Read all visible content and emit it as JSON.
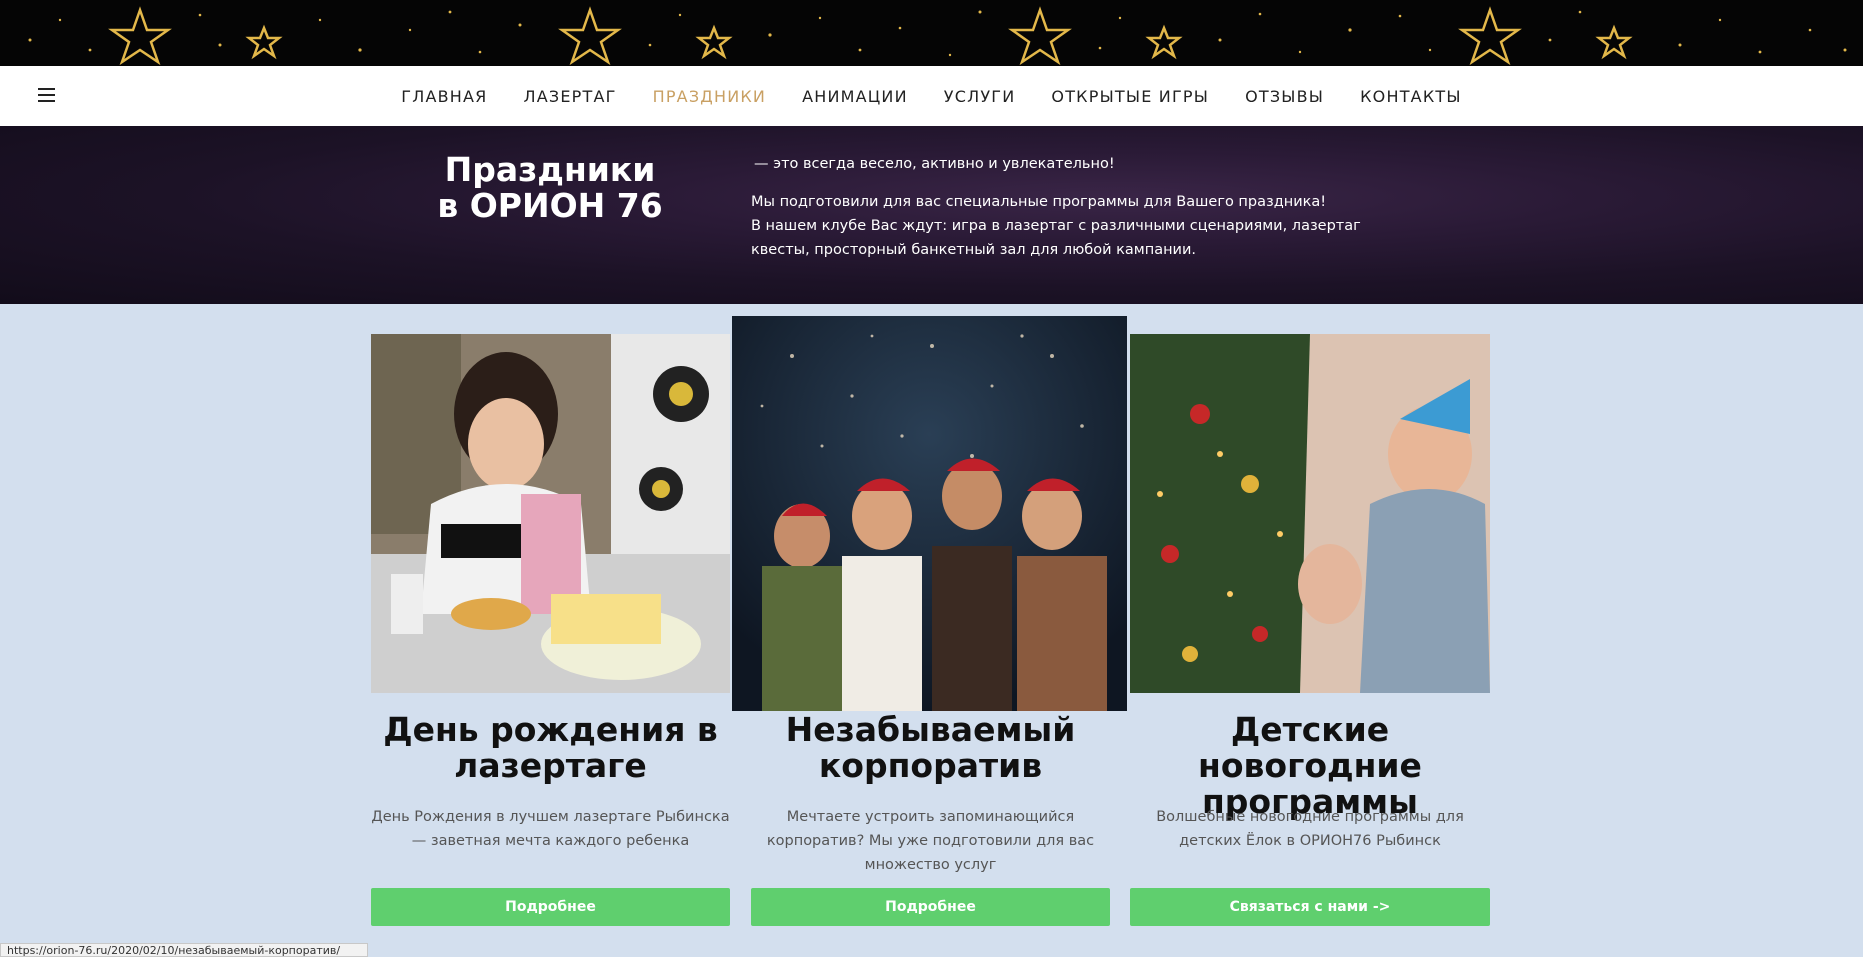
{
  "colors": {
    "nav_active": "#c9a063",
    "button_green": "#5fcf6e",
    "page_bg": "#d3dfee",
    "hero_bg": "#1c1226"
  },
  "icons": [
    "menu-icon",
    "star-decoration"
  ],
  "nav": {
    "items": [
      {
        "label": "ГЛАВНАЯ",
        "active": false
      },
      {
        "label": "ЛАЗЕРТАГ",
        "active": false
      },
      {
        "label": "ПРАЗДНИКИ",
        "active": true
      },
      {
        "label": "АНИМАЦИИ",
        "active": false
      },
      {
        "label": "УСЛУГИ",
        "active": false
      },
      {
        "label": "ОТКРЫТЫЕ ИГРЫ",
        "active": false
      },
      {
        "label": "ОТЗЫВЫ",
        "active": false
      },
      {
        "label": "КОНТАКТЫ",
        "active": false
      }
    ]
  },
  "hero": {
    "title": "Праздники в ОРИОН 76",
    "lead": "— это всегда весело, активно и увлекательно!",
    "line1": "Мы подготовили для вас специальные программы для Вашего праздника!",
    "line2": "В нашем клубе Вас ждут: игра в лазертаг с различными сценариями, лазертаг квесты, просторный банкетный зал для любой кампании."
  },
  "cards": [
    {
      "title": "День рождения в лазертаге",
      "description": "День Рождения в лучшем лазертаге Рыбинска — заветная мечта каждого ребенка",
      "button": "Подробнее"
    },
    {
      "title": "Незабываемый корпоратив",
      "description": "Мечтаете устроить запоминающийся корпоратив? Мы уже подготовили для вас множество услуг",
      "button": "Подробнее"
    },
    {
      "title": "Детские новогодние программы",
      "description": "Волшебные новогодние программы для детских Ёлок в ОРИОН76 Рыбинск",
      "button": "Связаться с нами ->"
    }
  ],
  "status_bar": {
    "url": "https://orion-76.ru/2020/02/10/незабываемый-корпоратив/"
  }
}
